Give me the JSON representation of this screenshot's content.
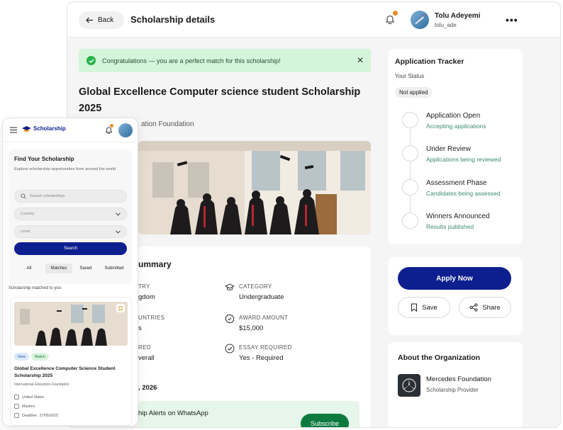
{
  "desktop": {
    "topbar": {
      "back_label": "Back",
      "title": "Scholarship details",
      "user_name": "Tolu Adeyemi",
      "user_handle": "tolu_ade"
    },
    "alert": {
      "message": "Congratulations — you are a perfect match for this scholarship!"
    },
    "scholarship": {
      "title": "Global Excellence Computer science student Scholarship 2025",
      "org_partial": "ation Foundation"
    },
    "summary": {
      "title_partial": "ummary",
      "left_labels": [
        "TRY",
        "UNTRIES",
        "RED"
      ],
      "left_values": [
        "gdom",
        "s",
        "verall"
      ],
      "category_label": "CATEGORY",
      "category_value": "Undergraduate",
      "award_label": "AWARD AMOUNT",
      "award_value": "$15,000",
      "essay_label": "ESSAY REQUIRED",
      "essay_value": "Yes - Required",
      "deadline_partial": ", 2026",
      "whatsapp_title": "hip Alerts on WhatsApp",
      "subscribe_label": "Subscribe"
    },
    "tracker": {
      "title": "Application Tracker",
      "status_label": "Your Status",
      "status_value": "Not applied",
      "steps": [
        {
          "title": "Application Open",
          "sub": "Accepting applications"
        },
        {
          "title": "Under Review",
          "sub": "Applications being reviewed"
        },
        {
          "title": "Assessment Phase",
          "sub": "Candidates being assessed"
        },
        {
          "title": "Winners Announced",
          "sub": "Results published"
        }
      ]
    },
    "actions": {
      "apply": "Apply Now",
      "save": "Save",
      "share": "Share"
    },
    "about": {
      "title": "About the Organization",
      "org_name": "Mercedes Foundation",
      "org_role": "Scholarship Provider"
    }
  },
  "mobile": {
    "logo": "Scholarship",
    "panel": {
      "title": "Find Your Scholarship",
      "subtitle": "Explore scholarship opportunities from around the world",
      "search_placeholder": "Search scholarships",
      "country": "Country",
      "level": "Level",
      "search_button": "Search"
    },
    "tabs": [
      "All",
      "Matches",
      "Saved",
      "Submitted"
    ],
    "matched_label": "Scholarship matched to you",
    "card": {
      "tags": [
        "New",
        "Match"
      ],
      "title": "Global Excellence Computer Science Student Scholarship 2025",
      "org": "International Education Foundation",
      "location": "United States",
      "level": "Masters",
      "deadline": "Deadline : 27/05/2025"
    }
  },
  "colors": {
    "primary": "#0d1f8f",
    "success_bg": "#d3f5d9",
    "success": "#27b24a",
    "whatsapp": "#0e7a3f"
  }
}
